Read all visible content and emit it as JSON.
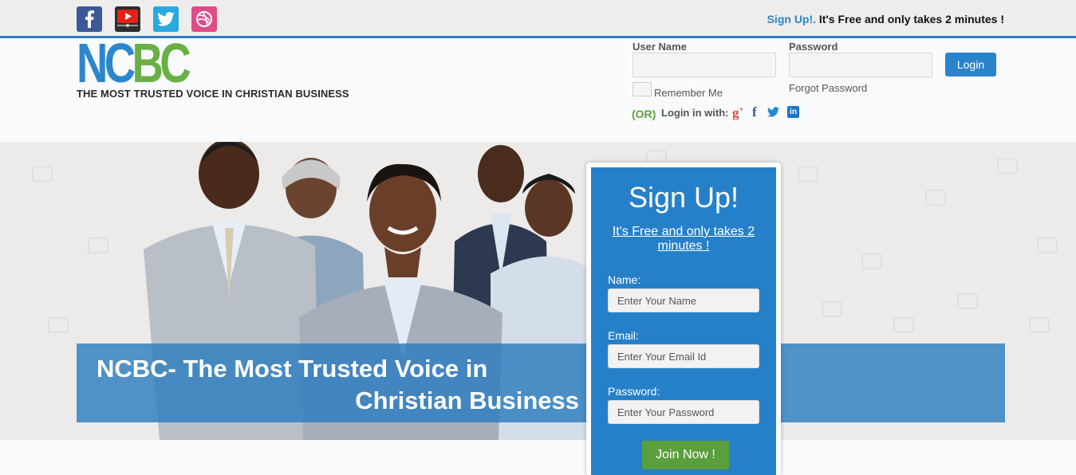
{
  "topbar": {
    "social": [
      "facebook-icon",
      "youtube-icon",
      "twitter-icon",
      "dribbble-icon"
    ],
    "signup_link": "Sign Up!.",
    "signup_text": " It's Free and only takes 2 minutes !"
  },
  "brand": {
    "logo_part1": "NC",
    "logo_part2": "BC",
    "tagline": "THE MOST TRUSTED VOICE IN CHRISTIAN BUSINESS",
    "colors": {
      "blue": "#2b86cc",
      "green": "#6aaf45"
    }
  },
  "login": {
    "username_label": "User Name",
    "password_label": "Password",
    "button": "Login",
    "remember": "Remember Me",
    "forgot": "Forgot Password",
    "or": "(OR)",
    "login_with": "Login in with:",
    "providers": [
      "google-plus-icon",
      "facebook-icon",
      "twitter-icon",
      "linkedin-icon"
    ]
  },
  "hero": {
    "banner_line1": "NCBC- The Most Trusted Voice in",
    "banner_line2": "Christian Business"
  },
  "signup": {
    "title": "Sign Up!",
    "subtitle": "It's Free and only takes 2 minutes !",
    "name_label": "Name:",
    "name_placeholder": "Enter Your Name",
    "email_label": "Email:",
    "email_placeholder": "Enter Your Email Id",
    "password_label": "Password:",
    "password_placeholder": "Enter Your Password",
    "button": "Join Now !"
  }
}
